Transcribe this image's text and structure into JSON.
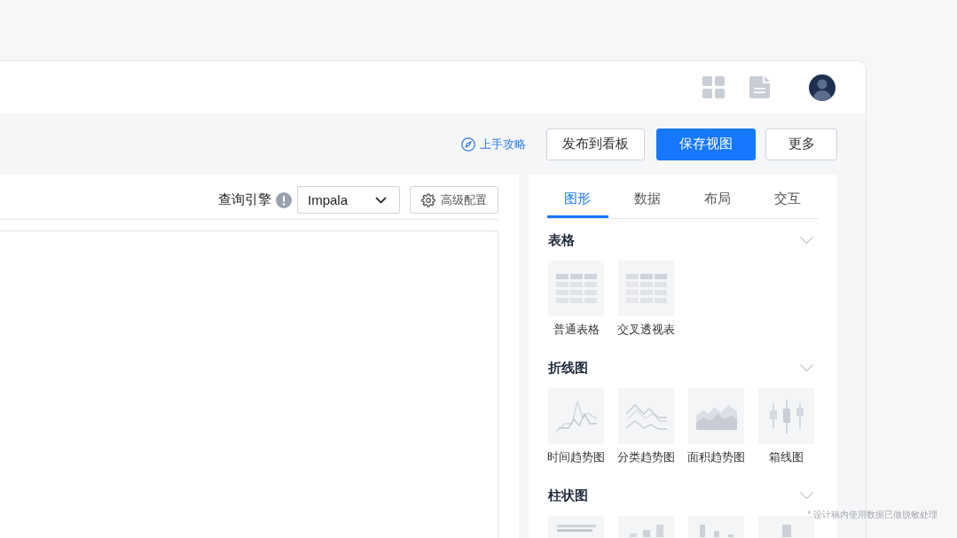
{
  "toolbar": {
    "guide_link": "上手攻略",
    "buttons": [
      {
        "label": "发布到看板",
        "kind": "default"
      },
      {
        "label": "保存视图",
        "kind": "primary"
      },
      {
        "label": "更多",
        "kind": "default"
      }
    ]
  },
  "query": {
    "label": "查询引擎",
    "engine": {
      "value": "Impala"
    },
    "advanced_button": "高级配置"
  },
  "panel": {
    "tabs": [
      {
        "label": "图形",
        "selected": true
      },
      {
        "label": "数据",
        "selected": false
      },
      {
        "label": "布局",
        "selected": false
      },
      {
        "label": "交互",
        "selected": false
      }
    ],
    "sections": [
      {
        "title": "表格",
        "expanded": true,
        "items": [
          {
            "kind": "table",
            "label": "普通表格"
          },
          {
            "kind": "pivot",
            "label": "交叉透视表"
          }
        ]
      },
      {
        "title": "折线图",
        "expanded": true,
        "items": [
          {
            "kind": "timeline",
            "label": "时间趋势图"
          },
          {
            "kind": "category",
            "label": "分类趋势图"
          },
          {
            "kind": "area",
            "label": "面积趋势图"
          },
          {
            "kind": "boxplot",
            "label": "箱线图"
          }
        ]
      },
      {
        "title": "柱状图",
        "expanded": true,
        "items": [
          {
            "kind": "hbar"
          },
          {
            "kind": "rising"
          },
          {
            "kind": "columns"
          },
          {
            "kind": "column"
          }
        ]
      }
    ]
  },
  "note": "* 设计稿内使用数据已做脱敏处理"
}
